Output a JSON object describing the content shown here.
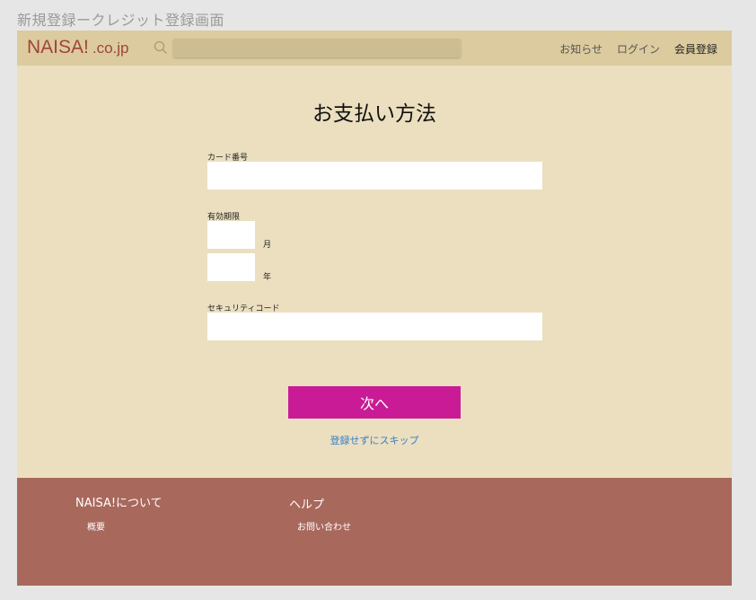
{
  "screen_title": "新規登録ークレジット登録画面",
  "header": {
    "logo_main": "NAISA!",
    "logo_sub": ".co.jp",
    "search_placeholder": "",
    "nav": {
      "news": "お知らせ",
      "login": "ログイン",
      "register": "会員登録"
    }
  },
  "main": {
    "heading": "お支払い方法",
    "card_number_label": "カード番号",
    "card_number_value": "",
    "expiry_label": "有効期限",
    "month_unit": "月",
    "year_unit": "年",
    "month_value": "",
    "year_value": "",
    "security_code_label": "セキュリティコード",
    "security_code_value": "",
    "next_button": "次へ",
    "skip_link": "登録せずにスキップ"
  },
  "footer": {
    "about_heading": "NAISA!について",
    "about_links": [
      "概要"
    ],
    "help_heading": "ヘルプ",
    "help_links": [
      "お問い合わせ"
    ]
  },
  "colors": {
    "page_bg": "#ebdfbf",
    "header_bg": "#dccb9e",
    "logo": "#a0443c",
    "button": "#c91b95",
    "link": "#3a7ec6",
    "footer_bg": "#a8685c"
  }
}
